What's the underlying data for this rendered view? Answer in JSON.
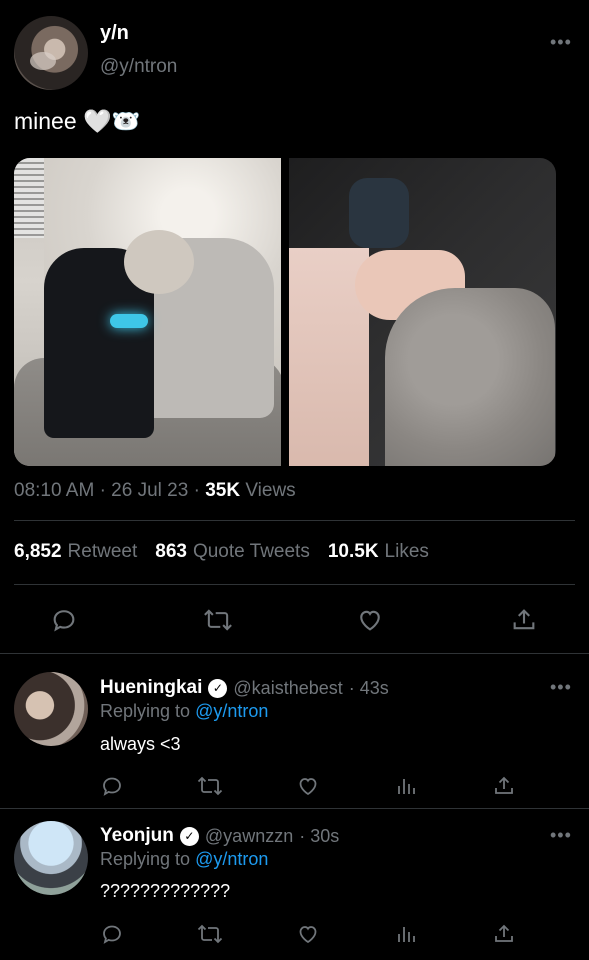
{
  "tweet": {
    "display_name": "y/n",
    "handle": "@y/ntron",
    "text": "minee 🤍🐻‍❄️",
    "time": "08:10 AM",
    "date": "26 Jul 23",
    "views_count": "35K",
    "views_label": "Views",
    "sep": "·",
    "stats": {
      "retweets_count": "6,852",
      "retweets_label": "Retweet",
      "quotes_count": "863",
      "quotes_label": "Quote Tweets",
      "likes_count": "10.5K",
      "likes_label": "Likes"
    },
    "more": "•••"
  },
  "icons": {
    "reply": "reply-icon",
    "retweet": "retweet-icon",
    "like": "heart-icon",
    "share": "share-icon",
    "analytics": "analytics-icon",
    "verified": "verified-badge-icon"
  },
  "replies": [
    {
      "display_name": "Hueningkai",
      "handle": "@kaisthebest",
      "age": "· 43s",
      "replying_to_label": "Replying to",
      "replying_to_handle": "@y/ntron",
      "text": "always <3"
    },
    {
      "display_name": "Yeonjun",
      "handle": "@yawnzzn",
      "age": "· 30s",
      "replying_to_label": "Replying to",
      "replying_to_handle": "@y/ntron",
      "text": "?????????????"
    }
  ],
  "colors": {
    "background": "#000000",
    "muted": "#71767b",
    "link": "#1d9bf0",
    "divider": "#2f3336"
  }
}
